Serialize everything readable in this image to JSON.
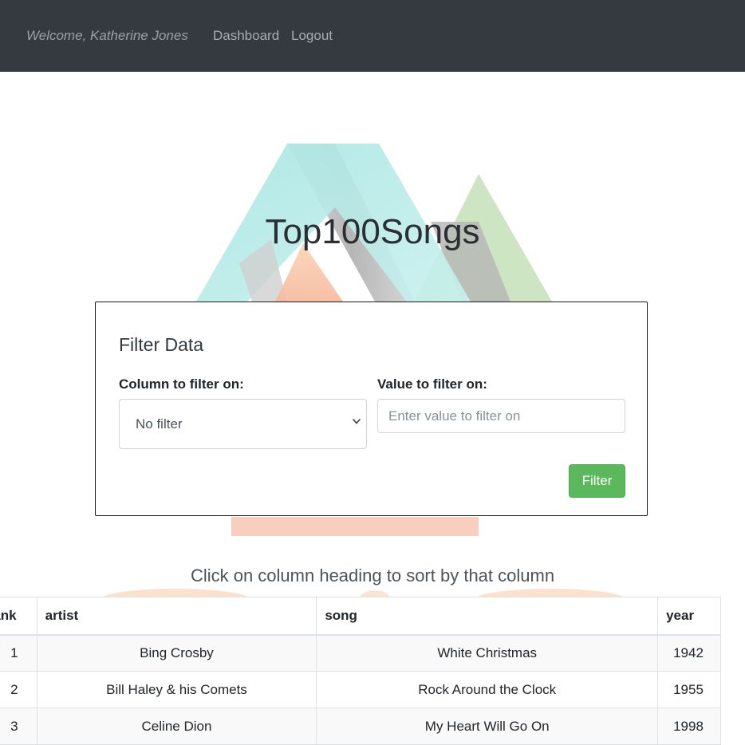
{
  "navbar": {
    "welcome": "Welcome, Katherine Jones",
    "links": [
      "Dashboard",
      "Logout"
    ]
  },
  "page_title": "Top100Songs",
  "filter": {
    "title": "Filter Data",
    "column_label": "Column to filter on:",
    "column_selected": "No filter",
    "value_label": "Value to filter on:",
    "value_placeholder": "Enter value to filter on",
    "value": "",
    "button_label": "Filter"
  },
  "sort_hint": "Click on column heading to sort by that column",
  "table": {
    "headers": [
      "rank",
      "artist",
      "song",
      "year"
    ],
    "rows": [
      [
        "1",
        "Bing Crosby",
        "White Christmas",
        "1942"
      ],
      [
        "2",
        "Bill Haley & his Comets",
        "Rock Around the Clock",
        "1955"
      ],
      [
        "3",
        "Celine Dion",
        "My Heart Will Go On",
        "1998"
      ]
    ]
  },
  "colors": {
    "navbar_bg": "#343a40",
    "filter_button": "#5cb85c",
    "logo_teal": "#a8e6e2",
    "logo_green": "#c5e0b8",
    "logo_orange": "#f9c9a8",
    "logo_gray": "#b8b8b8"
  }
}
